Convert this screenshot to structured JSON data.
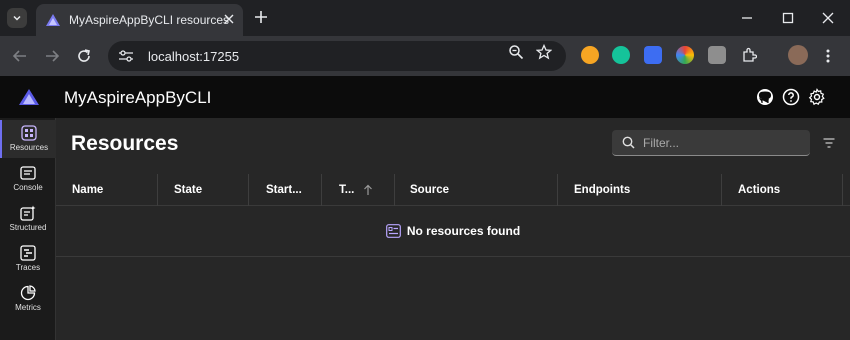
{
  "browser": {
    "tab_title": "MyAspireAppByCLI resources",
    "url": "localhost:17255"
  },
  "app": {
    "name": "MyAspireAppByCLI",
    "accent": "#6f6ff1"
  },
  "sidenav": {
    "items": [
      {
        "label": "Resources",
        "icon": "resources-icon",
        "active": true
      },
      {
        "label": "Console",
        "icon": "console-icon"
      },
      {
        "label": "Structured",
        "icon": "structured-icon"
      },
      {
        "label": "Traces",
        "icon": "traces-icon"
      },
      {
        "label": "Metrics",
        "icon": "metrics-icon"
      }
    ]
  },
  "page": {
    "title": "Resources",
    "filter_placeholder": "Filter..."
  },
  "table": {
    "columns": [
      "Name",
      "State",
      "Start...",
      "T...",
      "Source",
      "Endpoints",
      "Actions"
    ],
    "empty_message": "No resources found"
  }
}
